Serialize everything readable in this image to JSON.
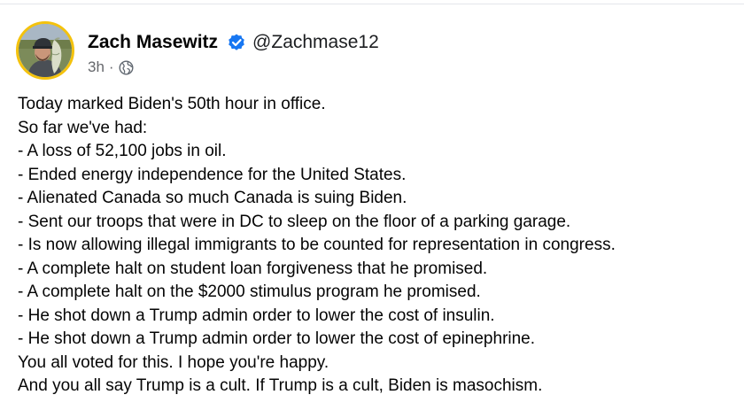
{
  "post": {
    "author": {
      "name": "Zach Masewitz",
      "handle": "@Zachmase12",
      "verified": true,
      "avatar_icon": "profile-photo-man-with-cap-holding-fish"
    },
    "timestamp": "3h",
    "separator": "·",
    "audience_icon": "globe-icon",
    "lines": [
      "Today marked Biden's 50th hour in office.",
      "So far we've had:",
      "- A loss of 52,100 jobs in oil.",
      "- Ended energy independence for the United States.",
      "- Alienated Canada so much Canada is suing Biden.",
      "- Sent our troops that were in DC to sleep on the floor of a parking garage.",
      "- Is now allowing illegal immigrants to be counted for representation in congress.",
      "- A complete halt on student loan forgiveness that he promised.",
      "- A complete halt on the $2000 stimulus program he promised.",
      "- He shot down a Trump admin order to lower the cost of insulin.",
      "- He shot down a Trump admin order to lower the cost of epinephrine.",
      "You all voted for this. I hope you're happy.",
      "And you all say Trump is a cult. If Trump is a cult, Biden is masochism."
    ]
  },
  "colors": {
    "verified_badge": "#1877f2",
    "avatar_ring": "#f4c20d",
    "meta_text": "#65676b",
    "body_text": "#050505"
  }
}
